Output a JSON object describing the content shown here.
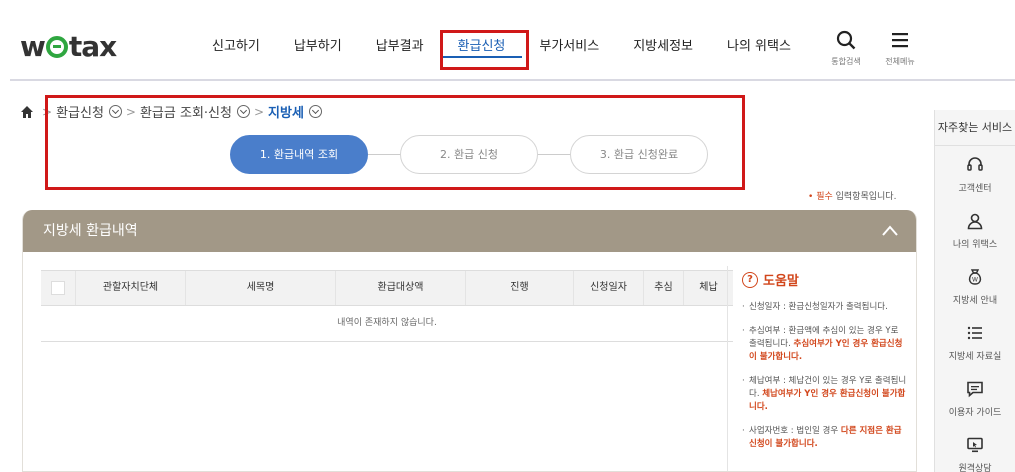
{
  "header": {
    "logo_left": "w",
    "logo_right": "tax",
    "nav": [
      "신고하기",
      "납부하기",
      "납부결과",
      "환급신청",
      "부가서비스",
      "지방세정보",
      "나의 위택스"
    ],
    "search_label": "통합검색",
    "menu_label": "전체메뉴"
  },
  "breadcrumb": {
    "items": [
      "환급신청",
      "환급금 조회·신청",
      "지방세"
    ]
  },
  "steps": [
    "1. 환급내역 조회",
    "2. 환급 신청",
    "3. 환급 신청완료"
  ],
  "required_note": {
    "mark": "•",
    "em": "필수",
    "text": " 입력항목입니다."
  },
  "panel": {
    "title": "지방세 환급내역",
    "columns": [
      "관할자치단체",
      "세목명",
      "환급대상액",
      "진행",
      "신청일자",
      "추심",
      "체납"
    ],
    "empty_message": "내역이 존재하지 않습니다."
  },
  "help": {
    "title": "도움말",
    "items": [
      {
        "text": "신청일자 : 환급신청일자가 출력됩니다.",
        "warn": ""
      },
      {
        "text": "추심여부 : 환급액에 추심이 있는 경우 Y로 출력됩니다. ",
        "warn": "추심여부가 Y인 경우 환급신청이 불가합니다."
      },
      {
        "text": "체납여부 : 체납건이 있는 경우 Y로 출력됩니다. ",
        "warn": "체납여부가 Y인 경우 환급신청이 불가합니다."
      },
      {
        "text": "사업자번호 : 법인일 경우 ",
        "warn": "다른 지점은 환급신청이 불가합니다."
      }
    ]
  },
  "quick": {
    "title": "자주찾는 서비스",
    "items": [
      "고객센터",
      "나의 위택스",
      "지방세 안내",
      "지방세 자료실",
      "이용자 가이드",
      "원격상담"
    ]
  },
  "colors": {
    "accent": "#1a5fb4",
    "step_active": "#4a7ecb",
    "panel_head": "#a29887",
    "warn": "#d2461b",
    "highlight": "#d01818"
  }
}
